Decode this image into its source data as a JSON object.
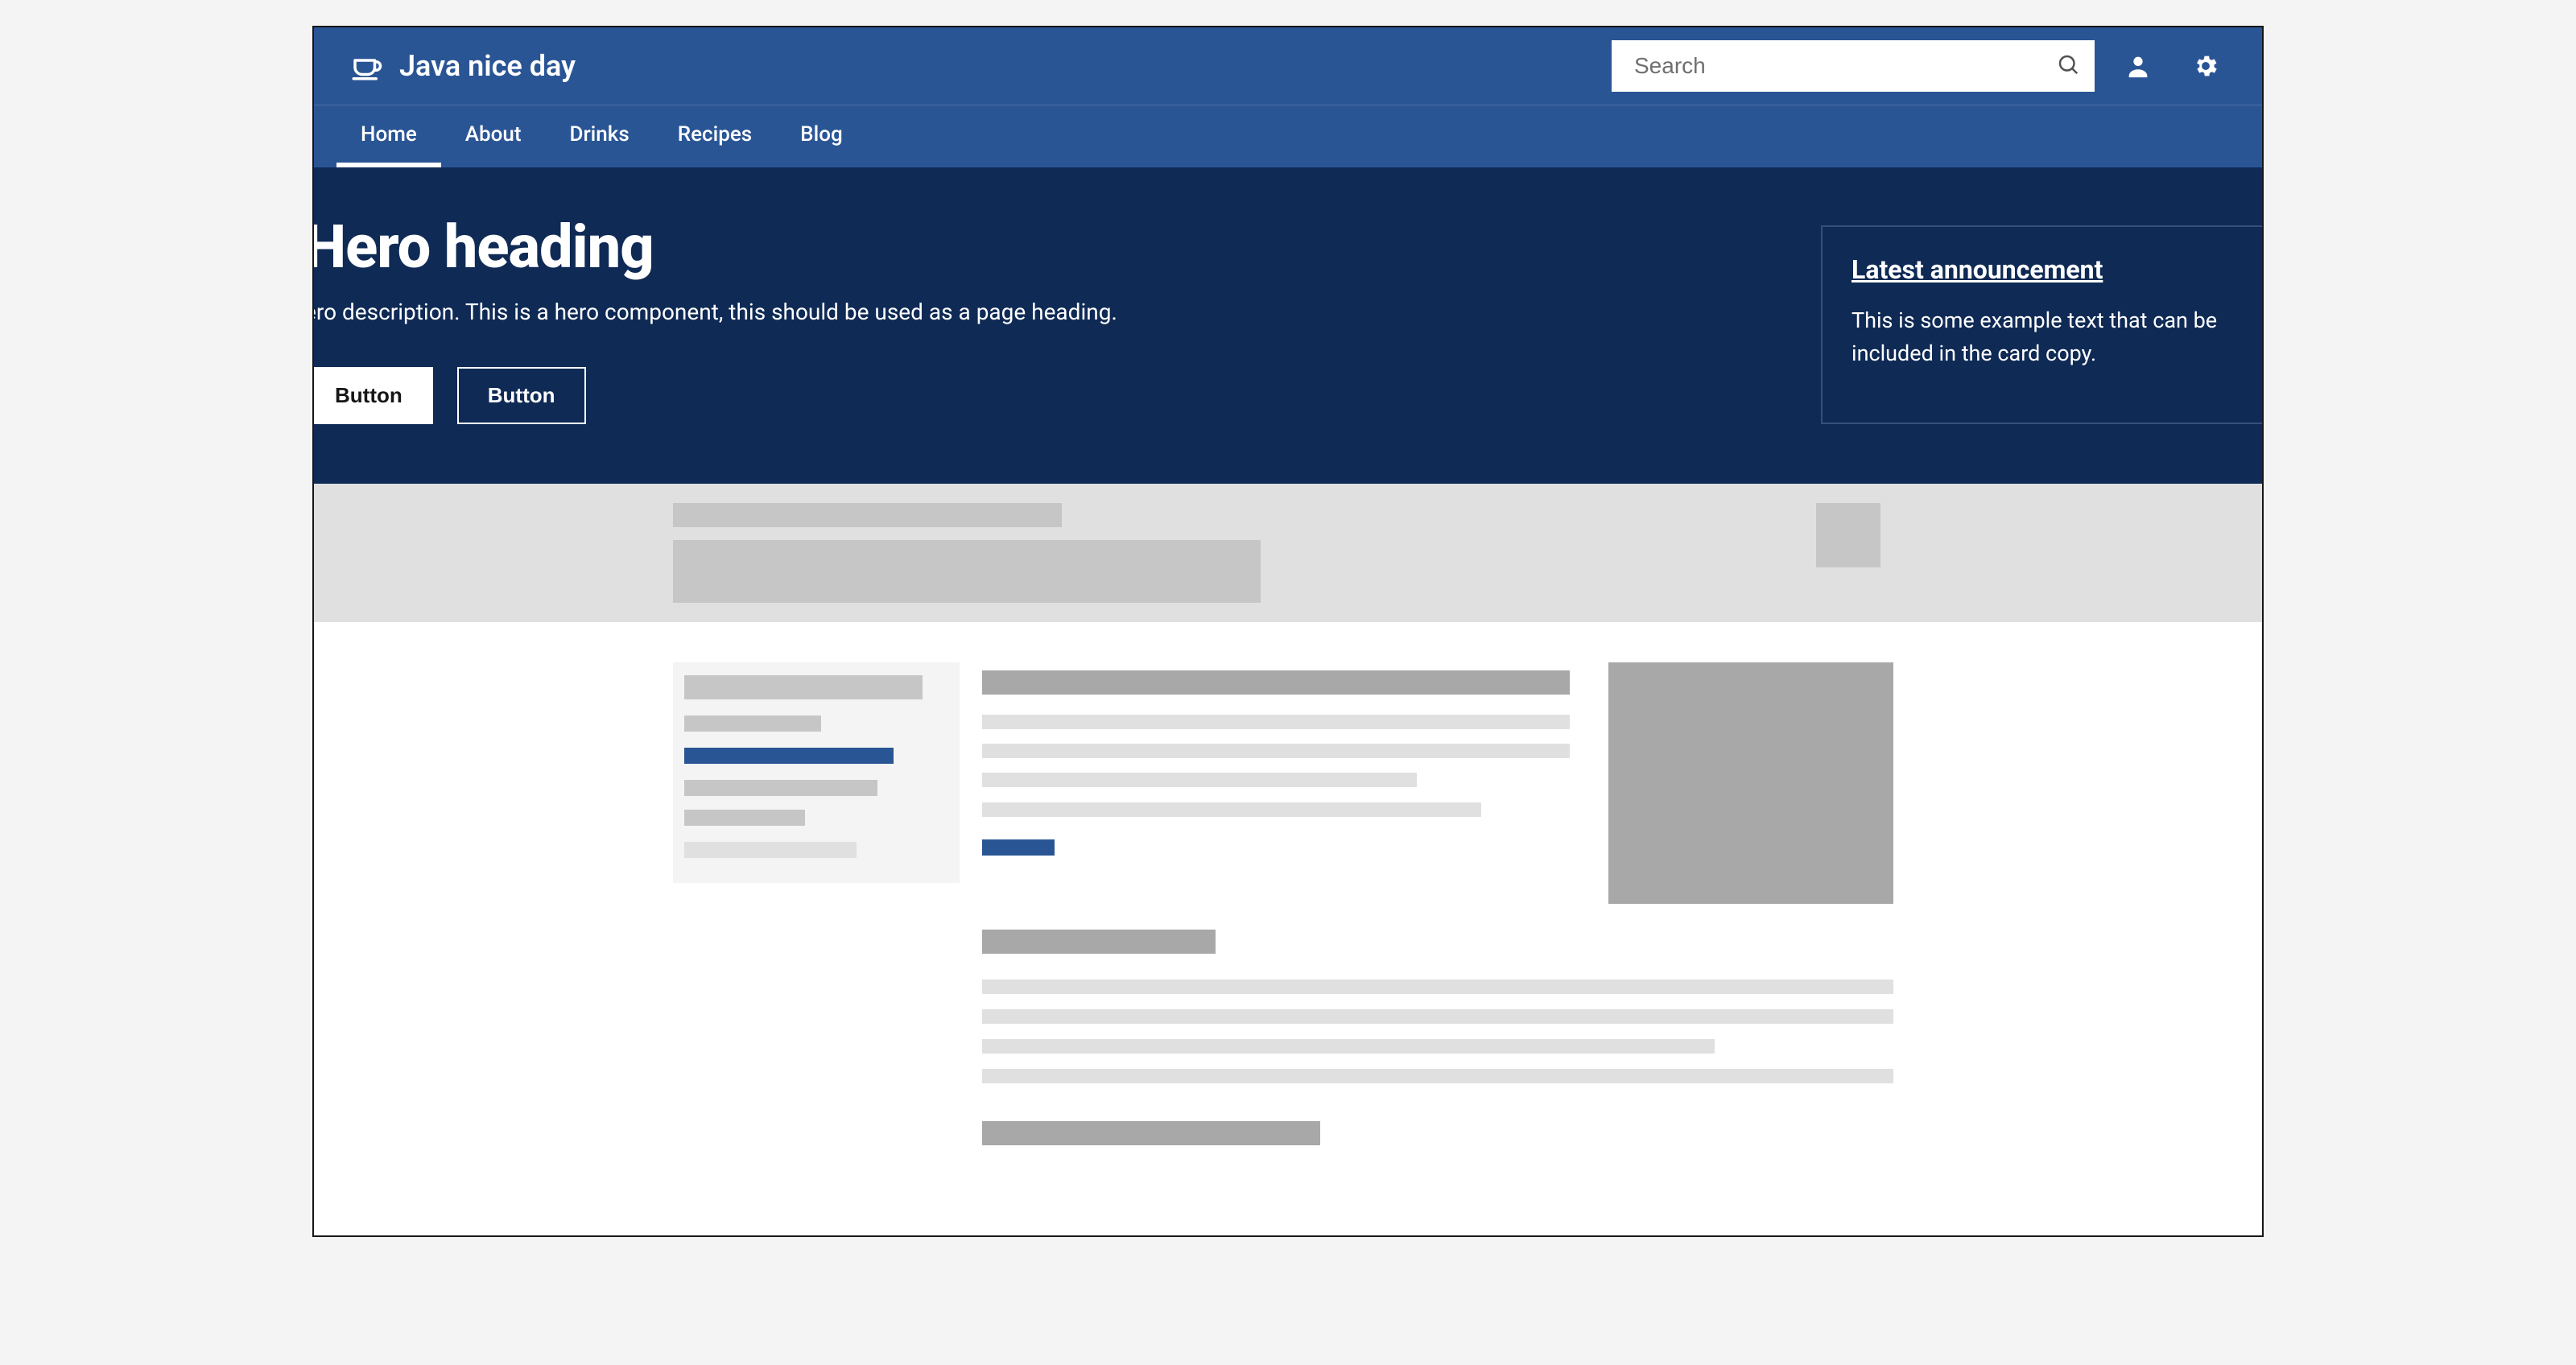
{
  "brand": {
    "title": "Java nice day"
  },
  "search": {
    "placeholder": "Search"
  },
  "nav": {
    "items": [
      {
        "label": "Home",
        "active": true
      },
      {
        "label": "About",
        "active": false
      },
      {
        "label": "Drinks",
        "active": false
      },
      {
        "label": "Recipes",
        "active": false
      },
      {
        "label": "Blog",
        "active": false
      }
    ]
  },
  "hero": {
    "heading": "Hero heading",
    "description": "ero description. This is a hero component, this should be used as a page heading.",
    "button_primary": "Button",
    "button_secondary": "Button"
  },
  "announcement": {
    "title": "Latest announcement",
    "body": "This is some example text that can be included in the card copy."
  }
}
